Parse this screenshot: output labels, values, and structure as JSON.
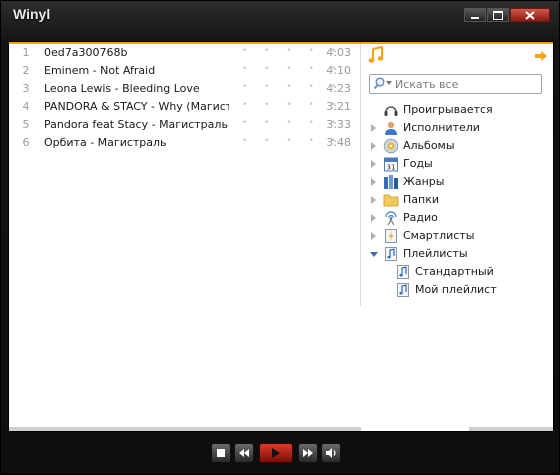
{
  "window": {
    "title": "Winyl"
  },
  "tracks": [
    {
      "num": "1",
      "title": "0ed7a300768b",
      "duration": "4:03"
    },
    {
      "num": "2",
      "title": "Eminem - Not Afraid",
      "duration": "4:10"
    },
    {
      "num": "3",
      "title": "Leona Lewis - Bleeding Love",
      "duration": "4:23"
    },
    {
      "num": "4",
      "title": "PANDORA & STACY - Why (Магист...",
      "duration": "3:21"
    },
    {
      "num": "5",
      "title": "Pandora feat Stacy - Магистраль",
      "duration": "3:33"
    },
    {
      "num": "6",
      "title": "Орбита - Магистраль",
      "duration": "3:48"
    }
  ],
  "rating_dots": "• • • • •",
  "search": {
    "placeholder": "Искать все"
  },
  "nav": {
    "now_playing": "Проигрывается",
    "artists": "Исполнители",
    "albums": "Альбомы",
    "years": "Годы",
    "genres": "Жанры",
    "folders": "Папки",
    "radio": "Радио",
    "smartlists": "Смартлисты",
    "playlists": "Плейлисты",
    "playlist_default": "Стандартный",
    "playlist_mine": "Мой плейлист"
  },
  "calendar_day": "31",
  "icons": [
    "music-note-icon",
    "forward-arrow-icon",
    "search-icon",
    "headphones-icon",
    "person-icon",
    "disc-icon",
    "calendar-icon",
    "books-icon",
    "folder-icon",
    "radio-icon",
    "lightning-icon",
    "playlist-icon",
    "stop-icon",
    "previous-icon",
    "play-icon",
    "next-icon",
    "volume-icon"
  ],
  "colors": {
    "accent": "#f5a314",
    "play": "#c8281a"
  }
}
